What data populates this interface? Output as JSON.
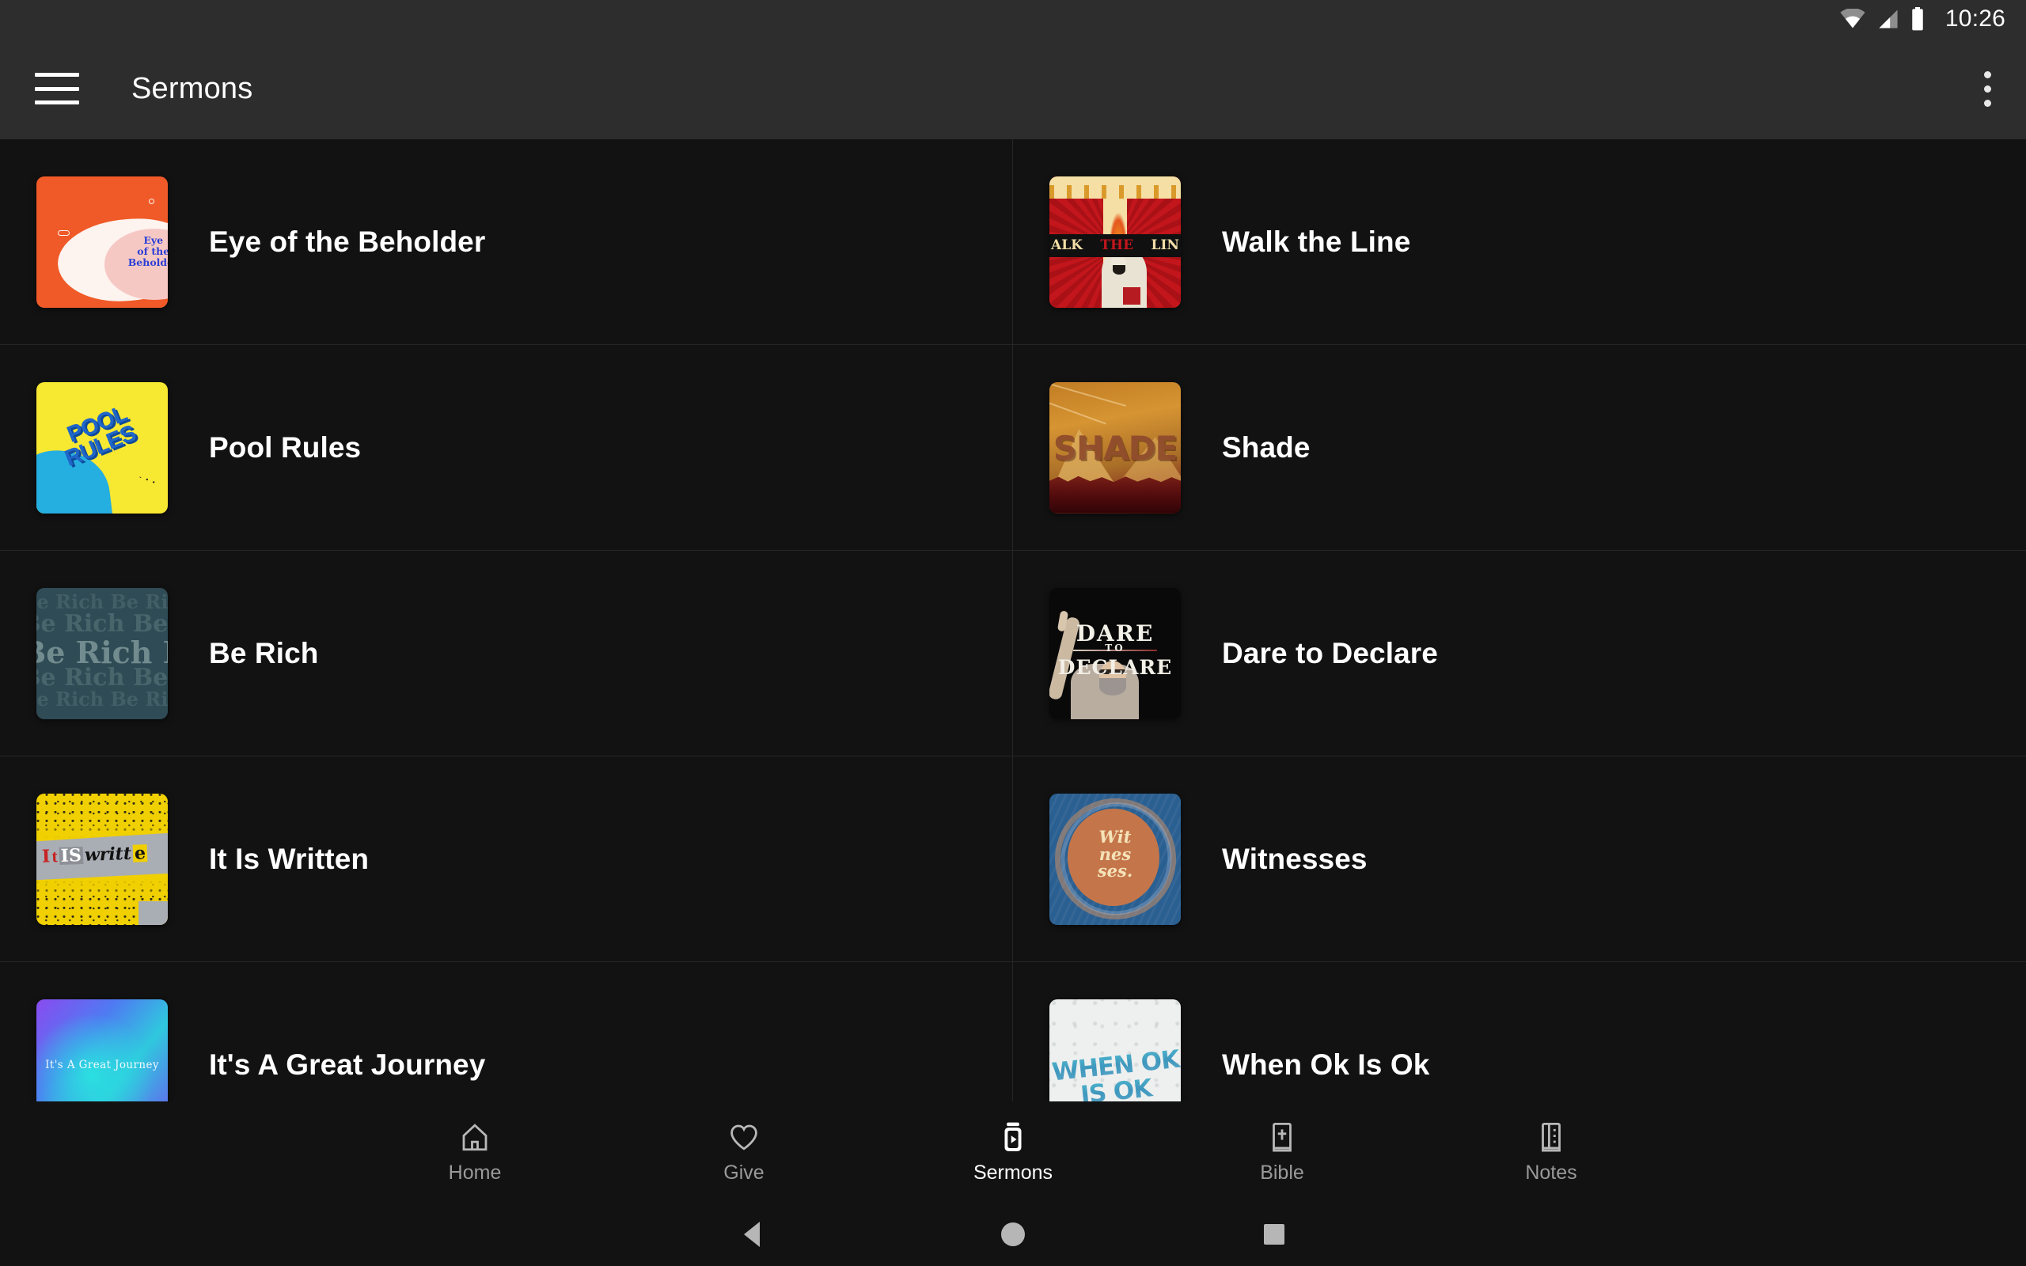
{
  "status_bar": {
    "time": "10:26",
    "icons": [
      "wifi-icon",
      "cellular-signal-icon",
      "battery-icon"
    ]
  },
  "app_bar": {
    "menu_icon": "hamburger-menu-icon",
    "title": "Sermons",
    "overflow_icon": "more-vertical-icon"
  },
  "sermons": [
    {
      "title": "Eye of the Beholder",
      "art": "eye",
      "art_text": "Eye of the Beholder"
    },
    {
      "title": "Walk the Line",
      "art": "walk",
      "art_text": "ALK THE LIN"
    },
    {
      "title": "Pool Rules",
      "art": "pool",
      "art_text": "POOL RULES"
    },
    {
      "title": "Shade",
      "art": "shade",
      "art_text": "SHADE"
    },
    {
      "title": "Be Rich",
      "art": "rich",
      "art_text": "Be Rich"
    },
    {
      "title": "Dare to Declare",
      "art": "dare",
      "art_text": "DARE TO DECLARE"
    },
    {
      "title": "It Is Written",
      "art": "written",
      "art_text": "It Is Written"
    },
    {
      "title": "Witnesses",
      "art": "witness",
      "art_text": "Wit nes ses."
    },
    {
      "title": "It's A Great Journey",
      "art": "journey",
      "art_text": "It's A Great Journey"
    },
    {
      "title": "When Ok Is Ok",
      "art": "whenok",
      "art_text": "WHEN OK IS OK"
    }
  ],
  "artwork_text": {
    "eye_l1": "Eye",
    "eye_l2": "of the",
    "eye_l3": "Beholder",
    "walk_left": "ALK",
    "walk_mid": "THE",
    "walk_right": "LIN",
    "pool_l1": "POOL",
    "pool_l2": "RULES",
    "shade": "SHADE",
    "rich_row": "Be Rich Be Rich Be Rich Be Rich",
    "dare_l1": "DARE",
    "dare_l2": "TO",
    "dare_l3": "DECLARE",
    "written_1": "I",
    "written_2": "t",
    "written_3": "IS",
    "written_4": "writt",
    "written_5": "e",
    "witness_l1": "Wit",
    "witness_l2": "nes",
    "witness_l3": "ses.",
    "journey": "It's A Great Journey",
    "ok_l1": "WHEN OK",
    "ok_l2": "IS OK"
  },
  "bottom_nav": {
    "items": [
      {
        "label": "Home",
        "icon": "home-icon",
        "active": false
      },
      {
        "label": "Give",
        "icon": "heart-icon",
        "active": false
      },
      {
        "label": "Sermons",
        "icon": "video-play-icon",
        "active": true
      },
      {
        "label": "Bible",
        "icon": "bible-book-icon",
        "active": false
      },
      {
        "label": "Notes",
        "icon": "notebook-icon",
        "active": false
      }
    ]
  },
  "system_nav": {
    "back": "back-triangle-icon",
    "home": "home-circle-icon",
    "recents": "recents-square-icon"
  },
  "colors": {
    "app_bar_bg": "#2d2d2d",
    "page_bg": "#121212",
    "divider": "#262626",
    "text_primary": "#ffffff",
    "text_inactive": "#9a9a9a"
  }
}
